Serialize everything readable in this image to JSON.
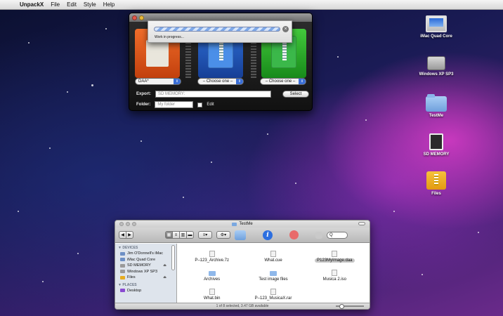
{
  "menubar": {
    "apple": "",
    "app_name": "UnpackX",
    "items": [
      "File",
      "Edit",
      "Style",
      "Help"
    ]
  },
  "unpackx": {
    "format_select": "DAA*",
    "choose_1": "– Choose one –",
    "choose_2": "– Choose one –",
    "export_label": "Export:",
    "export_value": "SD MEMORY:",
    "select_button": "Select",
    "folder_label": "Folder:",
    "folder_placeholder": "My folder",
    "edit_checkbox_label": "Edit"
  },
  "progress": {
    "label": "Work in progress...",
    "fraction": 1.0
  },
  "desktop_icons": [
    {
      "label": "iMac Quad Core",
      "icon": "imac-icon"
    },
    {
      "label": "Windows XP SP3",
      "icon": "drive-icon"
    },
    {
      "label": "TestMe",
      "icon": "folder-icon"
    },
    {
      "label": "SD MEMORY",
      "icon": "sd-card-icon"
    },
    {
      "label": "Files",
      "icon": "archive-icon"
    }
  ],
  "finder": {
    "title": "TestMe",
    "search_placeholder": "Q",
    "sidebar": {
      "devices_header": "▼ DEVICES",
      "places_header": "▼ PLACES",
      "devices": [
        "Jim O'Donnell's iMac",
        "iMac Quad Core",
        "SD MEMORY",
        "Windows XP SP3",
        "Files"
      ],
      "places": [
        "Desktop"
      ]
    },
    "files": [
      {
        "name": "P–123_Archive.7z",
        "kind": "file"
      },
      {
        "name": "What.cue",
        "kind": "file"
      },
      {
        "name": "P123MyImage.daa",
        "kind": "file",
        "selected": true
      },
      {
        "name": "Archives",
        "kind": "folder"
      },
      {
        "name": "Test image files",
        "kind": "folder"
      },
      {
        "name": "Musica 2.iso",
        "kind": "file"
      },
      {
        "name": "What.bin",
        "kind": "file"
      },
      {
        "name": "P–123_MusicaX.rar",
        "kind": "file"
      }
    ],
    "status": "1 of 8 selected, 3.47 GB available"
  },
  "colors": {
    "accent": "#3b6fd6",
    "tile_orange": "#e0561a",
    "tile_blue": "#2f6fd6",
    "tile_green": "#2fae2c"
  }
}
